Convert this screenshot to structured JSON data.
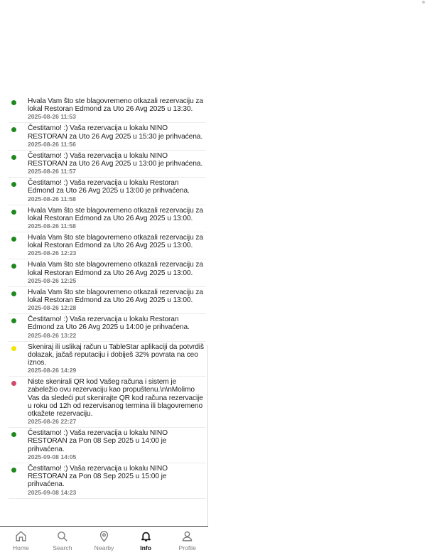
{
  "notifications": [
    {
      "status": "success",
      "color": "#1e8a1e",
      "message": "Hvala Vam što ste blagovremeno otkazali rezervaciju za lokal Restoran Edmond za Uto 26 Avg 2025 u 13:30.",
      "time": "2025-08-26 11:53"
    },
    {
      "status": "success",
      "color": "#1e8a1e",
      "message": "Čestitamo! :) Vaša rezervacija u lokalu NINO RESTORAN za Uto 26 Avg 2025 u 15:30 je prihvaćena.",
      "time": "2025-08-26 11:56"
    },
    {
      "status": "success",
      "color": "#1e8a1e",
      "message": "Čestitamo! :) Vaša rezervacija u lokalu NINO RESTORAN za Uto 26 Avg 2025 u 13:00 je prihvaćena.",
      "time": "2025-08-26 11:57"
    },
    {
      "status": "success",
      "color": "#1e8a1e",
      "message": "Čestitamo! :) Vaša rezervacija u lokalu Restoran Edmond za Uto 26 Avg 2025 u 13:00 je prihvaćena.",
      "time": "2025-08-26 11:58"
    },
    {
      "status": "success",
      "color": "#1e8a1e",
      "message": "Hvala Vam što ste blagovremeno otkazali rezervaciju za lokal Restoran Edmond za Uto 26 Avg 2025 u 13:00.",
      "time": "2025-08-26 11:58"
    },
    {
      "status": "success",
      "color": "#1e8a1e",
      "message": "Hvala Vam što ste blagovremeno otkazali rezervaciju za lokal Restoran Edmond za Uto 26 Avg 2025 u 13:00.",
      "time": "2025-08-26 12:23"
    },
    {
      "status": "success",
      "color": "#1e8a1e",
      "message": "Hvala Vam što ste blagovremeno otkazali rezervaciju za lokal Restoran Edmond za Uto 26 Avg 2025 u 13:00.",
      "time": "2025-08-26 12:25"
    },
    {
      "status": "success",
      "color": "#1e8a1e",
      "message": "Hvala Vam što ste blagovremeno otkazali rezervaciju za lokal Restoran Edmond za Uto 26 Avg 2025 u 13:00.",
      "time": "2025-08-26 12:28"
    },
    {
      "status": "success",
      "color": "#1e8a1e",
      "message": "Čestitamo! :) Vaša rezervacija u lokalu Restoran Edmond za Uto 26 Avg 2025 u 14:00 je prihvaćena.",
      "time": "2025-08-26 13:22"
    },
    {
      "status": "info",
      "color": "#f2e600",
      "message": "Skeniraj ili uslikaj račun u TableStar aplikaciji da potvrdiš dolazak, jačaš reputaciju i dobiješ 32% povrata na ceo iznos.",
      "time": "2025-08-26 14:29"
    },
    {
      "status": "warning",
      "color": "#d2476a",
      "message": "Niste skenirali QR kod Vašeg računa i sistem je zabeležio ovu rezervaciju kao propuštenu.\\n\\nMolimo Vas da sledeći put skenirajte QR kod računa rezervacije u roku od 12h od rezervisanog termina ili blagovremeno otkažete rezervaciju.",
      "time": "2025-08-26 22:27"
    },
    {
      "status": "success",
      "color": "#1e8a1e",
      "message": "Čestitamo! :) Vaša rezervacija u lokalu NINO RESTORAN za Pon 08 Sep 2025 u 14:00 je prihvaćena.",
      "time": "2025-09-08 14:05"
    },
    {
      "status": "success",
      "color": "#1e8a1e",
      "message": "Čestitamo! :) Vaša rezervacija u lokalu NINO RESTORAN za Pon 08 Sep 2025 u 15:00 je prihvaćena.",
      "time": "2025-09-08 14:23"
    }
  ],
  "nav": [
    {
      "label": "Home",
      "icon": "home-icon",
      "active": false
    },
    {
      "label": "Search",
      "icon": "search-icon",
      "active": false
    },
    {
      "label": "Nearby",
      "icon": "location-pin-icon",
      "active": false
    },
    {
      "label": "Info",
      "icon": "bell-icon",
      "active": true
    },
    {
      "label": "Profile",
      "icon": "person-icon",
      "active": false
    }
  ]
}
